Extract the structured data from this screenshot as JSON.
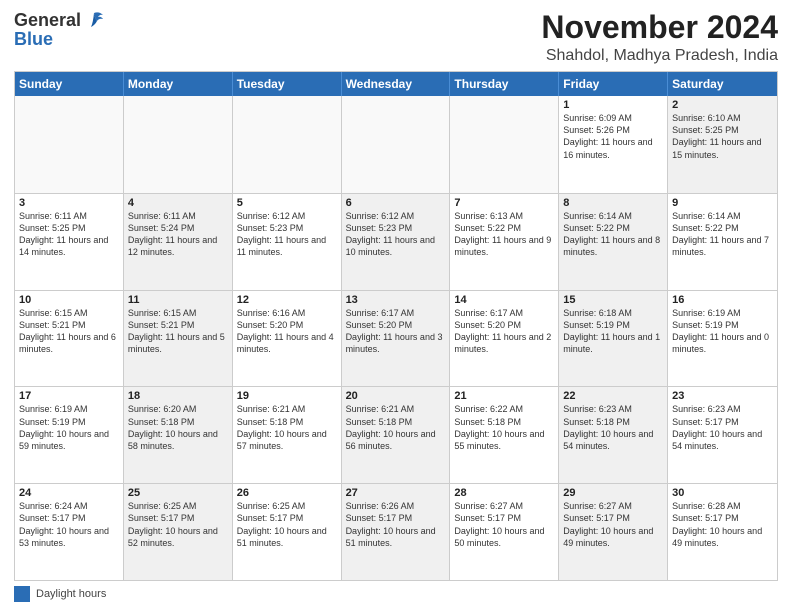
{
  "logo": {
    "general": "General",
    "blue": "Blue"
  },
  "header": {
    "title": "November 2024",
    "subtitle": "Shahdol, Madhya Pradesh, India"
  },
  "weekdays": [
    "Sunday",
    "Monday",
    "Tuesday",
    "Wednesday",
    "Thursday",
    "Friday",
    "Saturday"
  ],
  "weeks": [
    [
      {
        "day": "",
        "info": "",
        "empty": true
      },
      {
        "day": "",
        "info": "",
        "empty": true
      },
      {
        "day": "",
        "info": "",
        "empty": true
      },
      {
        "day": "",
        "info": "",
        "empty": true
      },
      {
        "day": "",
        "info": "",
        "empty": true
      },
      {
        "day": "1",
        "info": "Sunrise: 6:09 AM\nSunset: 5:26 PM\nDaylight: 11 hours and 16 minutes.",
        "empty": false
      },
      {
        "day": "2",
        "info": "Sunrise: 6:10 AM\nSunset: 5:25 PM\nDaylight: 11 hours and 15 minutes.",
        "empty": false,
        "shaded": true
      }
    ],
    [
      {
        "day": "3",
        "info": "Sunrise: 6:11 AM\nSunset: 5:25 PM\nDaylight: 11 hours and 14 minutes.",
        "empty": false
      },
      {
        "day": "4",
        "info": "Sunrise: 6:11 AM\nSunset: 5:24 PM\nDaylight: 11 hours and 12 minutes.",
        "empty": false,
        "shaded": true
      },
      {
        "day": "5",
        "info": "Sunrise: 6:12 AM\nSunset: 5:23 PM\nDaylight: 11 hours and 11 minutes.",
        "empty": false
      },
      {
        "day": "6",
        "info": "Sunrise: 6:12 AM\nSunset: 5:23 PM\nDaylight: 11 hours and 10 minutes.",
        "empty": false,
        "shaded": true
      },
      {
        "day": "7",
        "info": "Sunrise: 6:13 AM\nSunset: 5:22 PM\nDaylight: 11 hours and 9 minutes.",
        "empty": false
      },
      {
        "day": "8",
        "info": "Sunrise: 6:14 AM\nSunset: 5:22 PM\nDaylight: 11 hours and 8 minutes.",
        "empty": false,
        "shaded": true
      },
      {
        "day": "9",
        "info": "Sunrise: 6:14 AM\nSunset: 5:22 PM\nDaylight: 11 hours and 7 minutes.",
        "empty": false
      }
    ],
    [
      {
        "day": "10",
        "info": "Sunrise: 6:15 AM\nSunset: 5:21 PM\nDaylight: 11 hours and 6 minutes.",
        "empty": false
      },
      {
        "day": "11",
        "info": "Sunrise: 6:15 AM\nSunset: 5:21 PM\nDaylight: 11 hours and 5 minutes.",
        "empty": false,
        "shaded": true
      },
      {
        "day": "12",
        "info": "Sunrise: 6:16 AM\nSunset: 5:20 PM\nDaylight: 11 hours and 4 minutes.",
        "empty": false
      },
      {
        "day": "13",
        "info": "Sunrise: 6:17 AM\nSunset: 5:20 PM\nDaylight: 11 hours and 3 minutes.",
        "empty": false,
        "shaded": true
      },
      {
        "day": "14",
        "info": "Sunrise: 6:17 AM\nSunset: 5:20 PM\nDaylight: 11 hours and 2 minutes.",
        "empty": false
      },
      {
        "day": "15",
        "info": "Sunrise: 6:18 AM\nSunset: 5:19 PM\nDaylight: 11 hours and 1 minute.",
        "empty": false,
        "shaded": true
      },
      {
        "day": "16",
        "info": "Sunrise: 6:19 AM\nSunset: 5:19 PM\nDaylight: 11 hours and 0 minutes.",
        "empty": false
      }
    ],
    [
      {
        "day": "17",
        "info": "Sunrise: 6:19 AM\nSunset: 5:19 PM\nDaylight: 10 hours and 59 minutes.",
        "empty": false
      },
      {
        "day": "18",
        "info": "Sunrise: 6:20 AM\nSunset: 5:18 PM\nDaylight: 10 hours and 58 minutes.",
        "empty": false,
        "shaded": true
      },
      {
        "day": "19",
        "info": "Sunrise: 6:21 AM\nSunset: 5:18 PM\nDaylight: 10 hours and 57 minutes.",
        "empty": false
      },
      {
        "day": "20",
        "info": "Sunrise: 6:21 AM\nSunset: 5:18 PM\nDaylight: 10 hours and 56 minutes.",
        "empty": false,
        "shaded": true
      },
      {
        "day": "21",
        "info": "Sunrise: 6:22 AM\nSunset: 5:18 PM\nDaylight: 10 hours and 55 minutes.",
        "empty": false
      },
      {
        "day": "22",
        "info": "Sunrise: 6:23 AM\nSunset: 5:18 PM\nDaylight: 10 hours and 54 minutes.",
        "empty": false,
        "shaded": true
      },
      {
        "day": "23",
        "info": "Sunrise: 6:23 AM\nSunset: 5:17 PM\nDaylight: 10 hours and 54 minutes.",
        "empty": false
      }
    ],
    [
      {
        "day": "24",
        "info": "Sunrise: 6:24 AM\nSunset: 5:17 PM\nDaylight: 10 hours and 53 minutes.",
        "empty": false
      },
      {
        "day": "25",
        "info": "Sunrise: 6:25 AM\nSunset: 5:17 PM\nDaylight: 10 hours and 52 minutes.",
        "empty": false,
        "shaded": true
      },
      {
        "day": "26",
        "info": "Sunrise: 6:25 AM\nSunset: 5:17 PM\nDaylight: 10 hours and 51 minutes.",
        "empty": false
      },
      {
        "day": "27",
        "info": "Sunrise: 6:26 AM\nSunset: 5:17 PM\nDaylight: 10 hours and 51 minutes.",
        "empty": false,
        "shaded": true
      },
      {
        "day": "28",
        "info": "Sunrise: 6:27 AM\nSunset: 5:17 PM\nDaylight: 10 hours and 50 minutes.",
        "empty": false
      },
      {
        "day": "29",
        "info": "Sunrise: 6:27 AM\nSunset: 5:17 PM\nDaylight: 10 hours and 49 minutes.",
        "empty": false,
        "shaded": true
      },
      {
        "day": "30",
        "info": "Sunrise: 6:28 AM\nSunset: 5:17 PM\nDaylight: 10 hours and 49 minutes.",
        "empty": false
      }
    ]
  ],
  "legend": {
    "label": "Daylight hours"
  }
}
